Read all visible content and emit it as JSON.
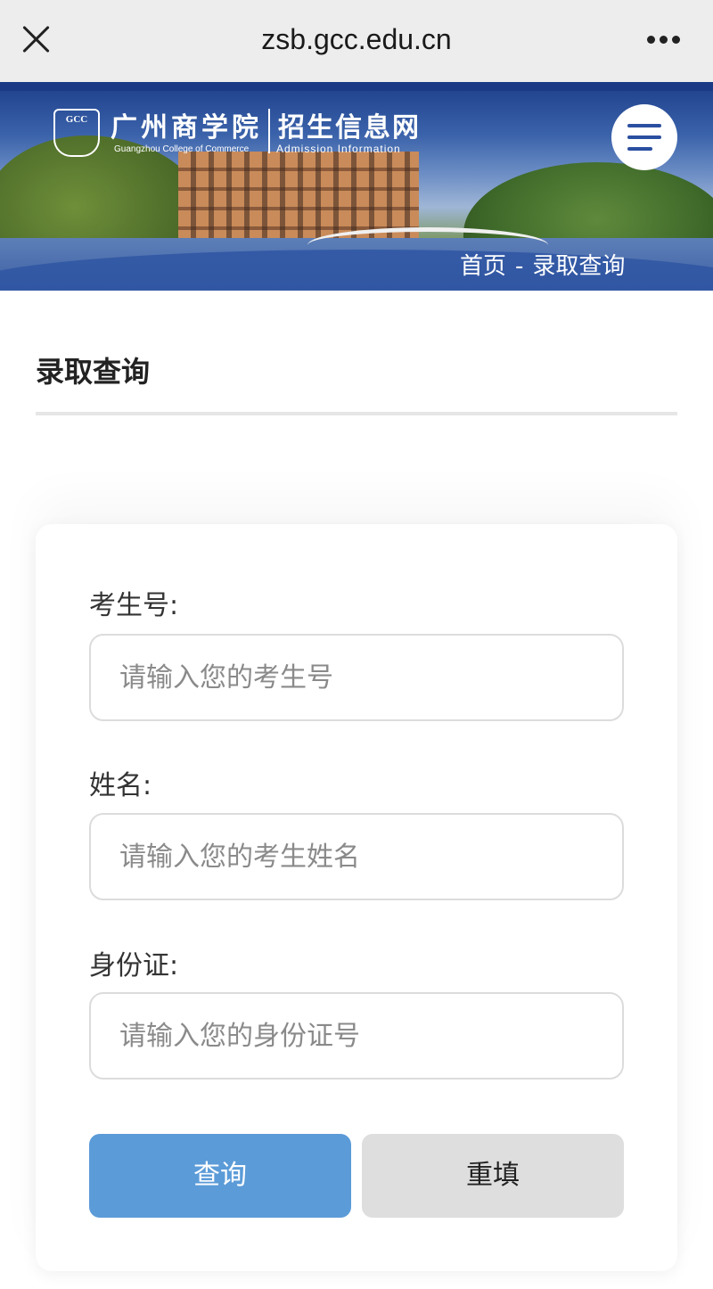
{
  "browser": {
    "url": "zsb.gcc.edu.cn"
  },
  "header": {
    "logo_emblem": "GCC",
    "school_name_cn": "广州商学院",
    "site_name_cn": "招生信息网",
    "school_name_en": "Guangzhou College of Commerce",
    "site_name_en": "Admission Information"
  },
  "breadcrumb": {
    "home": "首页",
    "separator": "-",
    "current": "录取查询"
  },
  "page": {
    "title": "录取查询"
  },
  "form": {
    "exam_no": {
      "label": "考生号:",
      "placeholder": "请输入您的考生号",
      "value": ""
    },
    "name": {
      "label": "姓名:",
      "placeholder": "请输入您的考生姓名",
      "value": ""
    },
    "id_card": {
      "label": "身份证:",
      "placeholder": "请输入您的身份证号",
      "value": ""
    },
    "query_label": "查询",
    "reset_label": "重填"
  },
  "colors": {
    "primary_button": "#5b9bd8",
    "reset_button": "#dedede",
    "brand_blue": "#2a4fa0"
  },
  "icons": {
    "close": "close-icon",
    "more": "more-dots-icon",
    "menu": "hamburger-menu-icon"
  }
}
